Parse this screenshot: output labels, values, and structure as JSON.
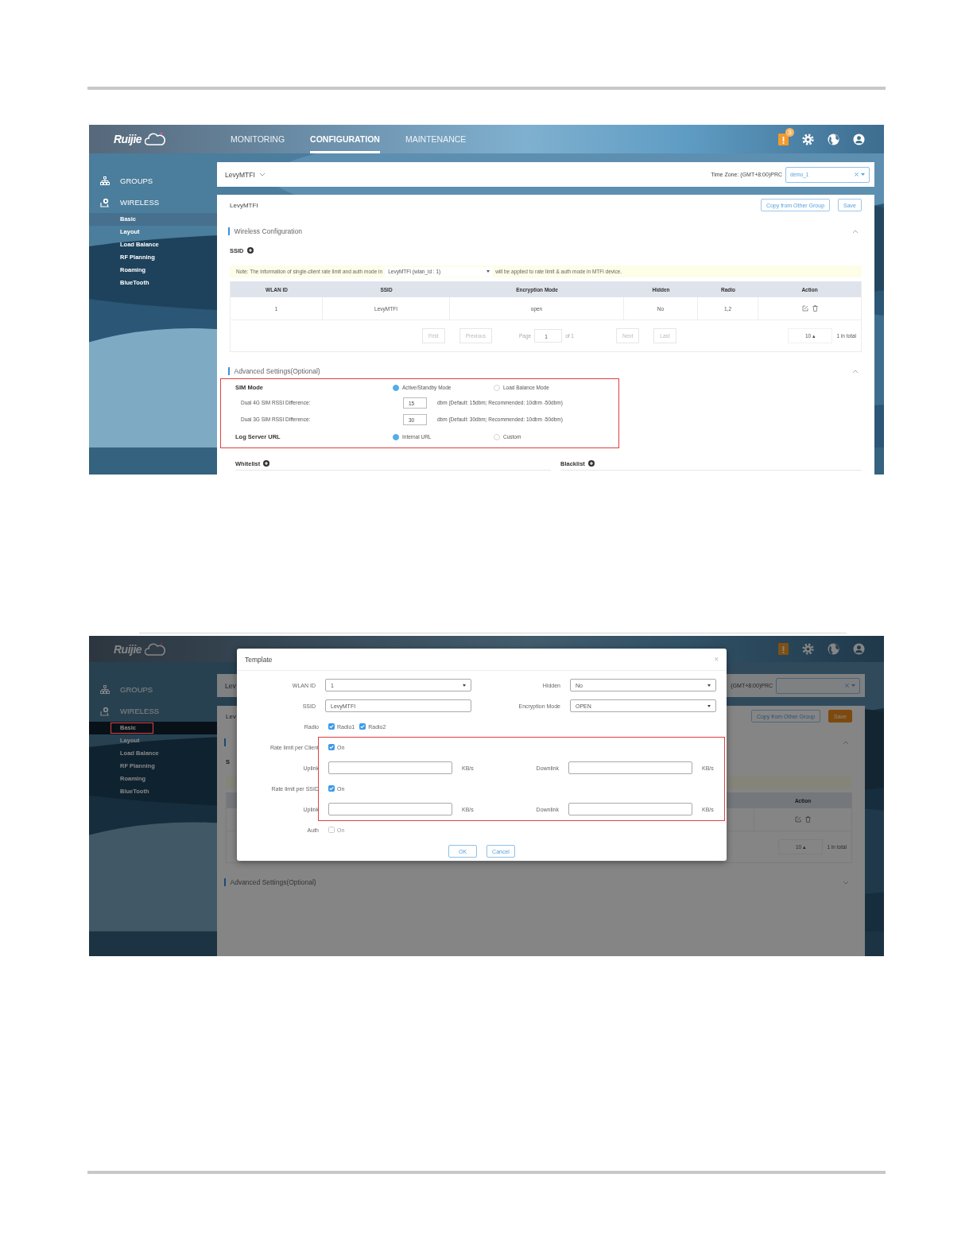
{
  "shot1": {
    "logo": "Ruijie",
    "nav": [
      {
        "label": "MONITORING",
        "selected": false
      },
      {
        "label": "CONFIGURATION",
        "selected": true
      },
      {
        "label": "MAINTENANCE",
        "selected": false
      }
    ],
    "alert_count": "3",
    "sidebar": [
      {
        "kind": "groups",
        "label": "GROUPS"
      },
      {
        "kind": "wireless",
        "label": "WIRELESS",
        "children": [
          {
            "label": "Basic",
            "selected": true
          },
          {
            "label": "Layout",
            "selected": false
          },
          {
            "label": "Load Balance",
            "selected": false
          },
          {
            "label": "RF Planning",
            "selected": false
          },
          {
            "label": "Roaming",
            "selected": false
          },
          {
            "label": "BlueTooth",
            "selected": false
          }
        ]
      }
    ],
    "group_bar": {
      "group": "LevyMTFI",
      "timezone": "Time Zone: (GMT+8:00)PRC",
      "dropdown": "demo_1"
    },
    "card_title": "LevyMTFI",
    "buttons": [
      {
        "label": "Copy from Other Group",
        "kind": "outline"
      },
      {
        "label": "Save",
        "kind": "outline"
      }
    ],
    "wireless": {
      "title": "Wireless Configuration",
      "ssid_label": "SSID",
      "note_before": "Note: The information of single-client rate limit and auth mode in",
      "note_select": "LevyMTFI (wlan_id : 1)",
      "note_after": "will be applied to rate limit & auth mode in MTFi device.",
      "columns": [
        "WLAN ID",
        "SSID",
        "Encryption Mode",
        "Hidden",
        "Radio",
        "Action"
      ],
      "rows": [
        [
          "1",
          "LevyMTFI",
          "open",
          "No",
          "1,2"
        ]
      ],
      "pager": {
        "first": "First",
        "previous": "Previous",
        "page_label": "Page",
        "page": "1",
        "of": "of 1",
        "next": "Next",
        "last": "Last",
        "page_size": "10 ▴",
        "total": "1 in total"
      }
    },
    "advanced": {
      "title": "Advanced Settings(Optional)",
      "rows": [
        {
          "kind": "radio",
          "label": "SIM Mode",
          "options": [
            {
              "label": "Active/Standby Mode",
              "selected": true
            },
            {
              "label": "Load Balance Mode",
              "selected": false
            }
          ]
        },
        {
          "kind": "number",
          "label": "Dual 4G SIM RSSI Difference:",
          "value": "15",
          "hint": "dbm (Default: 15dbm; Recommended: 10dbm -50dbm)"
        },
        {
          "kind": "number",
          "label": "Dual 3G SIM RSSI Difference:",
          "value": "30",
          "hint": "dbm (Default: 30dbm; Recommended: 10dbm -50dbm)"
        },
        {
          "kind": "radio",
          "label": "Log Server URL",
          "options": [
            {
              "label": "Internal URL",
              "selected": true
            },
            {
              "label": "Custom",
              "selected": false
            }
          ]
        }
      ],
      "lists": [
        "Whitelist",
        "Blacklist"
      ]
    }
  },
  "shot2": {
    "logo": "Ruijie",
    "sidebar": [
      {
        "kind": "groups",
        "label": "GROUPS"
      },
      {
        "kind": "wireless",
        "label": "WIRELESS",
        "children": [
          {
            "label": "Basic",
            "selected": true
          },
          {
            "label": "Layout",
            "selected": false
          },
          {
            "label": "Load Balance",
            "selected": false
          },
          {
            "label": "RF Planning",
            "selected": false
          },
          {
            "label": "Roaming",
            "selected": false
          },
          {
            "label": "BlueTooth",
            "selected": false
          }
        ]
      }
    ],
    "group_bar": {
      "group": "Lev",
      "timezone": "(GMT+8:00)PRC"
    },
    "card_title": "Lev",
    "buttons": [
      {
        "label": "Copy from Other Group",
        "kind": "outline"
      },
      {
        "label": "Save",
        "kind": "filled"
      }
    ],
    "ssid_label": "S",
    "action_column": "Action",
    "pager": {
      "page_size": "10 ▴",
      "total": "1 in total"
    },
    "advanced_title": "Advanced Settings(Optional)",
    "modal": {
      "title": "Template",
      "close": "×",
      "fields": [
        {
          "label": "WLAN ID",
          "kind": "select",
          "value": "1"
        },
        {
          "label": "Hidden",
          "kind": "select",
          "value": "No"
        },
        {
          "label": "SSID",
          "kind": "text",
          "value": "LevyMTFI"
        },
        {
          "label": "Encryption Mode",
          "kind": "select",
          "value": "OPEN"
        }
      ],
      "radio": {
        "label": "Radio",
        "options": [
          {
            "label": "Radio1",
            "checked": true
          },
          {
            "label": "Radio2",
            "checked": true
          }
        ]
      },
      "limits": [
        {
          "label": "Rate limit per Client",
          "toggle": {
            "label": "On",
            "checked": true
          },
          "uplink": "Uplink",
          "downlink": "Downlink",
          "units": [
            "KB/s",
            "KB/s"
          ]
        },
        {
          "label": "Rate limit per SSID",
          "toggle": {
            "label": "On",
            "checked": true
          },
          "uplink": "Uplink",
          "downlink": "Downlink",
          "units": [
            "KB/s",
            "KB/s"
          ]
        }
      ],
      "auth": {
        "label": "Auth",
        "toggle": {
          "label": "On",
          "checked": false
        }
      },
      "buttons": [
        "OK",
        "Cancel"
      ]
    }
  }
}
